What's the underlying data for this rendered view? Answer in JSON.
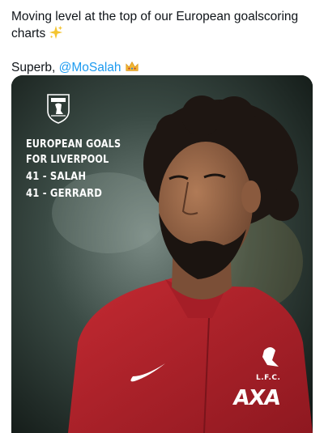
{
  "tweet": {
    "text_line1": "Moving level at the top of our European goalscoring",
    "text_line2": "charts",
    "sparkle_icon": "sparkles-icon",
    "text_prefix": "Superb, ",
    "mention": "@MoSalah",
    "crown_icon": "crown-icon",
    "mention_color": "#1d9bf0"
  },
  "graphic": {
    "heading_line1": "EUROPEAN GOALS",
    "heading_line2": "FOR LIVERPOOL",
    "stats": [
      "41 - SALAH",
      "41 - GERRARD"
    ],
    "crest_icon": "liverpool-crest-icon",
    "shirt_badge_text": "L.F.C.",
    "sponsor": "AXA",
    "shirt_color": "#b8202a"
  }
}
